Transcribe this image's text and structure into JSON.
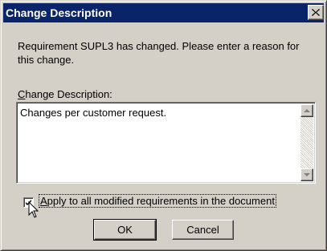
{
  "window": {
    "title": "Change Description"
  },
  "message": {
    "text": "Requirement SUPL3 has changed.  Please enter a reason for this change."
  },
  "change_description": {
    "label_accel": "C",
    "label_rest": "hange Description:",
    "value": "Changes per customer request."
  },
  "apply_all": {
    "checked": true,
    "label_accel": "A",
    "label_rest": "pply to all modified requirements in the document"
  },
  "buttons": {
    "ok": "OK",
    "cancel": "Cancel"
  },
  "colors": {
    "titlebar": "#0a246a",
    "face": "#d4d0c8"
  },
  "icons": [
    "close-icon",
    "scroll-up-arrow-icon",
    "scroll-down-arrow-icon",
    "checkmark-icon",
    "mouse-pointer-icon"
  ]
}
